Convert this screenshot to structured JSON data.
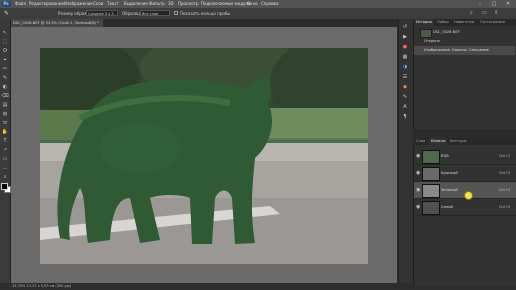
{
  "app": {
    "logo": "Ps"
  },
  "menus": [
    "Файл",
    "Редактирование",
    "Изображение",
    "Слои",
    "Текст",
    "Выделение",
    "Фильтр",
    "3D",
    "Просмотр",
    "Подключаемые модули",
    "Окно",
    "Справка"
  ],
  "options": {
    "mode_label": "Размер образца:",
    "mode_value": "Среднее 5 x 5",
    "sample_label": "Образец:",
    "sample_value": "Все слои",
    "show_ring_label": "Показать кольцо пробы"
  },
  "document": {
    "tab_title": "DSC_0028.NEF @ 33,3% (Слой 1, Зеленый/8) *"
  },
  "tools": [
    "↖",
    "⬚",
    "ʘ",
    "⌖",
    "✂",
    "✎",
    "◐",
    "⌫",
    "▤",
    "◍",
    "⬭",
    "✋",
    "T",
    "↗",
    "▭",
    "…",
    "⌕"
  ],
  "status": {
    "text": "33,33%   13,37 x 5,93 см (300 ppi)"
  },
  "history": {
    "tabs": [
      "История",
      "Набор",
      "Навигатор",
      "Гистограмма"
    ],
    "items": [
      {
        "label": "DSC_0028.NEF"
      },
      {
        "label": "Открыть"
      },
      {
        "label": "Изображение: Каналы: Смешение"
      }
    ]
  },
  "layers": {
    "tabs": [
      "Слои",
      "Каналы",
      "Контуры"
    ],
    "channels": [
      {
        "name": "RGB",
        "shortcut": "Ctrl+2",
        "selected": false
      },
      {
        "name": "Красный",
        "shortcut": "Ctrl+3",
        "selected": false
      },
      {
        "name": "Зеленый",
        "shortcut": "Ctrl+4",
        "selected": true
      },
      {
        "name": "Синий",
        "shortcut": "Ctrl+5",
        "selected": false
      }
    ]
  },
  "colors": {
    "menubar": "#535353",
    "canvas_bg": "#6b6b6b",
    "panel_bg": "#323232",
    "selected_row": "#555555",
    "bear_green": "#2f5a33"
  }
}
